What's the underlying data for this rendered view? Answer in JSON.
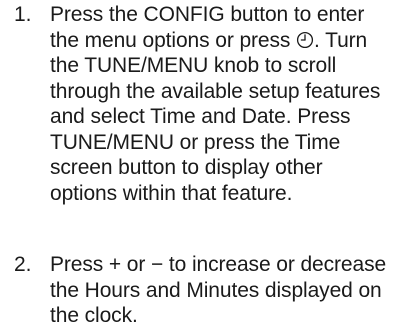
{
  "steps": [
    {
      "number": "1.",
      "text_before_icon": "Press the CONFIG button to enter the menu options or press ",
      "icon": "clock-icon",
      "text_after_icon": ". Turn the TUNE/MENU knob to scroll through the available setup features and select Time and Date. Press TUNE/MENU or press the Time screen button to display other options within that feature."
    },
    {
      "number": "2.",
      "text": "Press + or − to increase or decrease the Hours and Minutes displayed on the clock."
    }
  ]
}
